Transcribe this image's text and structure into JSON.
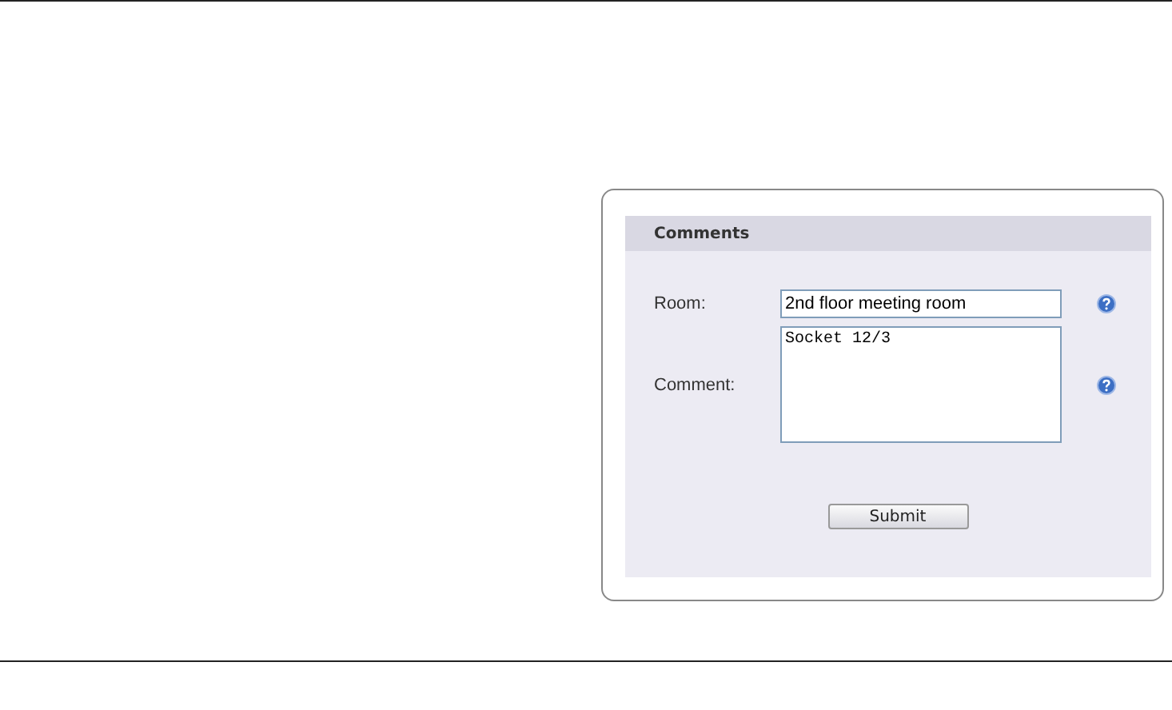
{
  "panel": {
    "title": "Comments"
  },
  "fields": [
    {
      "kind": "input",
      "label": "Room:",
      "value": "2nd floor meeting room"
    },
    {
      "kind": "textarea",
      "label": "Comment:",
      "value": "Socket 12/3"
    }
  ],
  "submit": "Submit"
}
